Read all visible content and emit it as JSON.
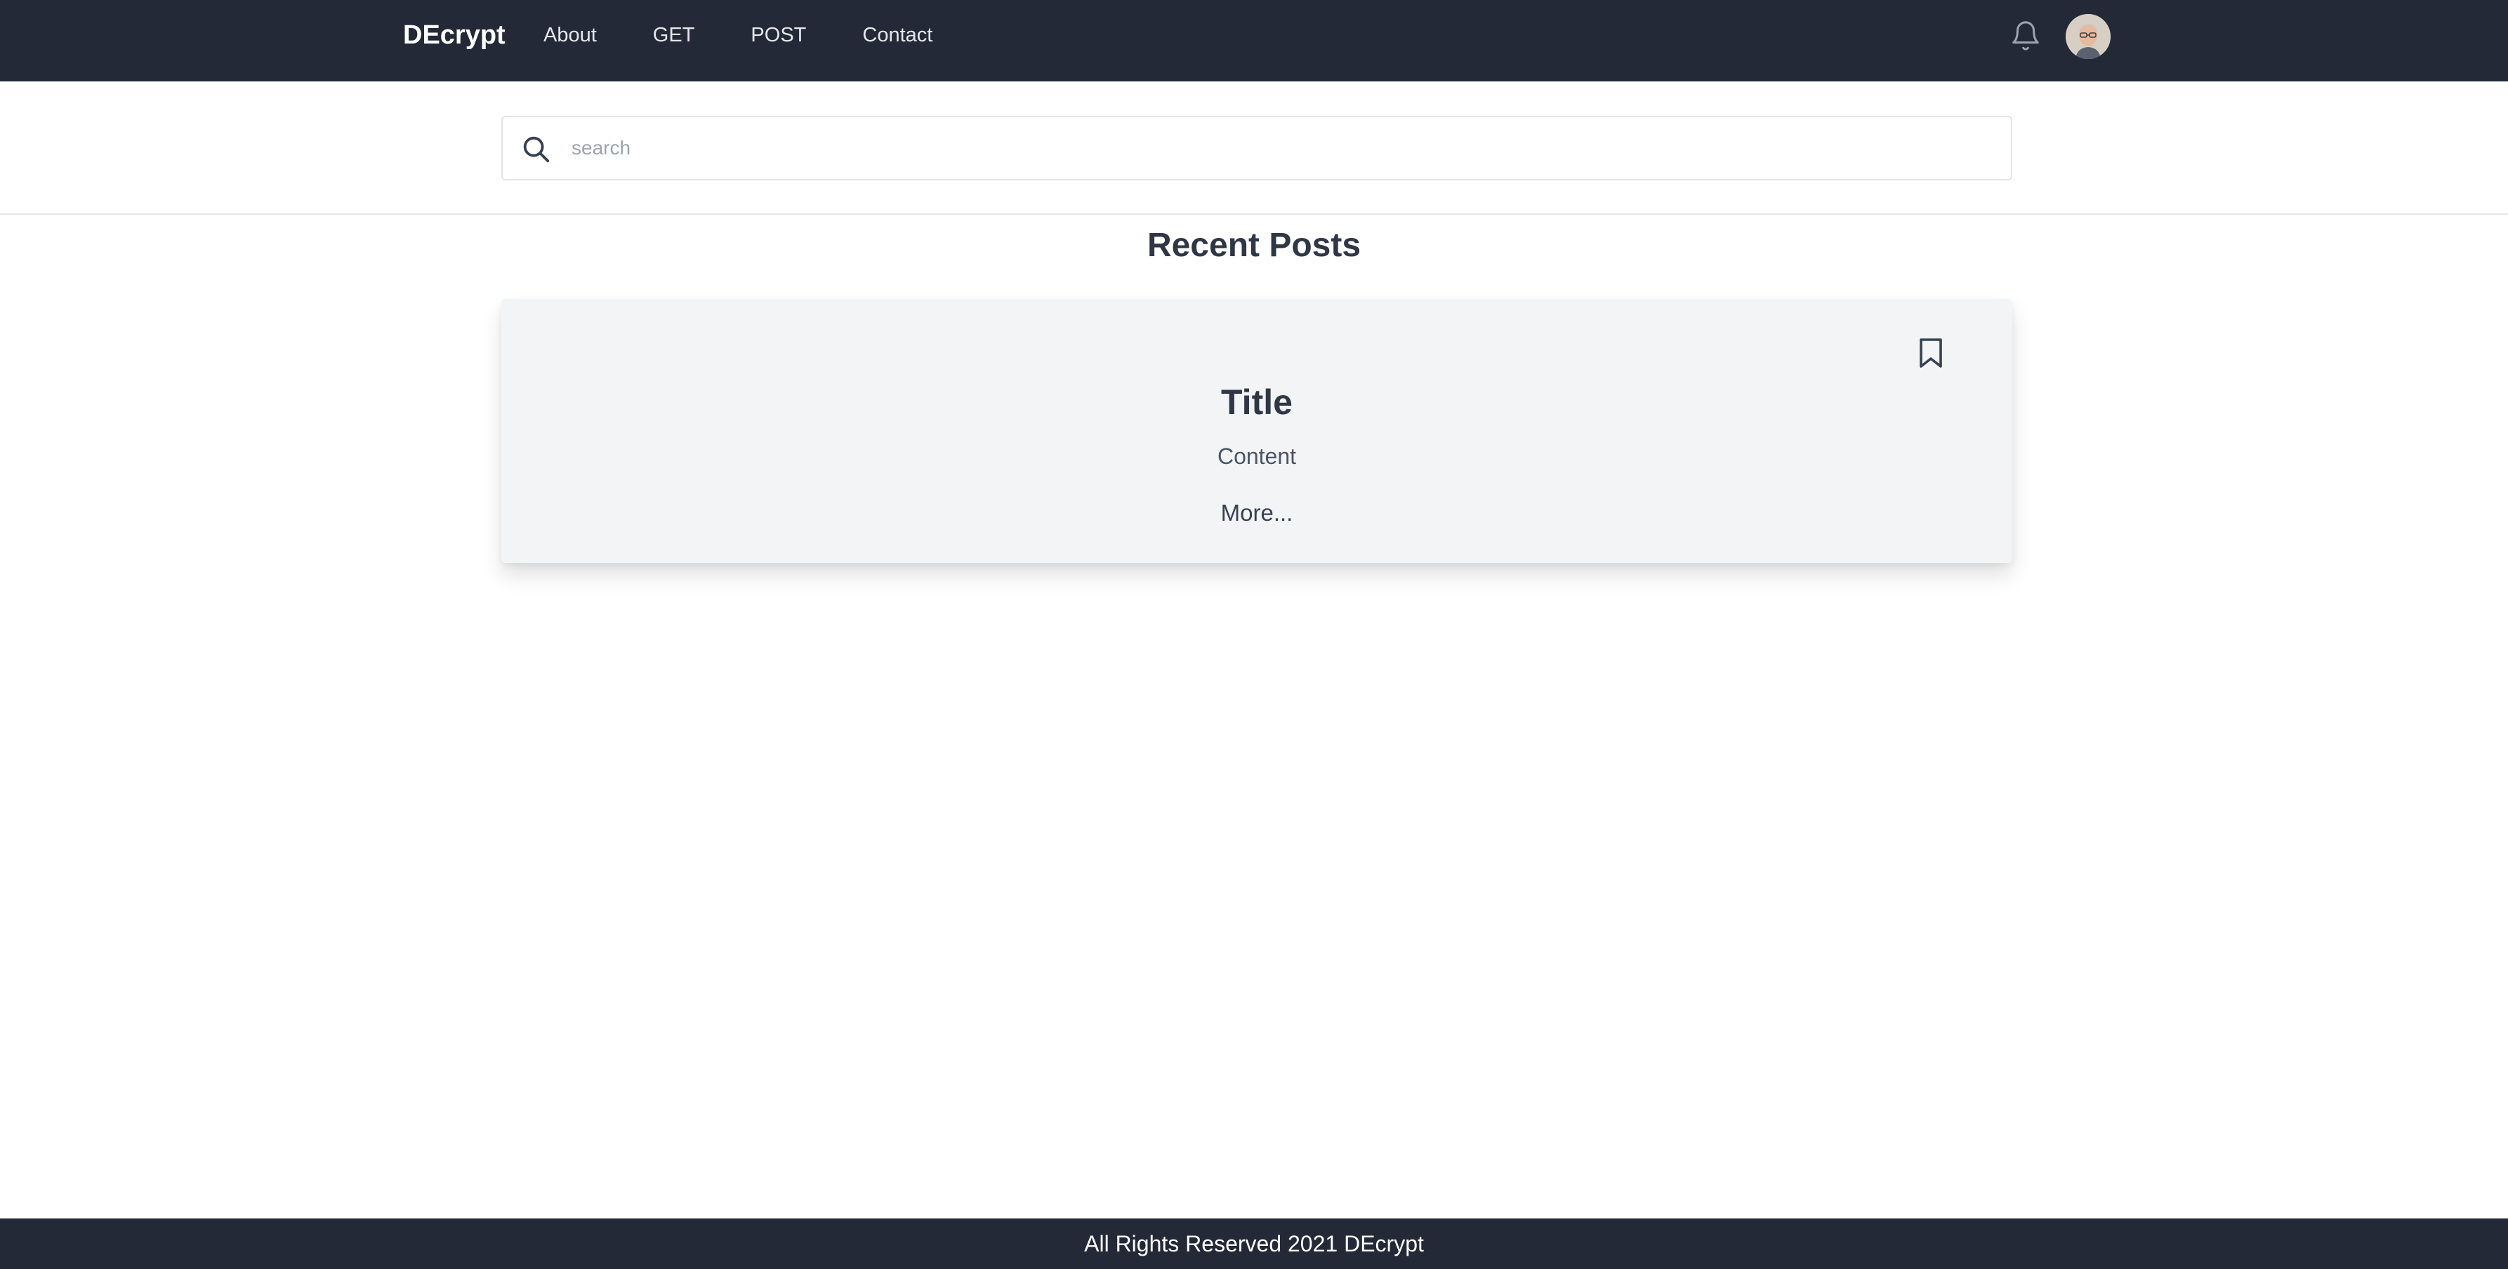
{
  "navbar": {
    "brand": "DEcrypt",
    "links": [
      "About",
      "GET",
      "POST",
      "Contact"
    ],
    "icons": {
      "notifications": "bell-icon",
      "profile": "avatar"
    }
  },
  "search": {
    "placeholder": "search",
    "value": "",
    "icon": "search-icon"
  },
  "main": {
    "heading": "Recent Posts",
    "posts": [
      {
        "title": "Title",
        "content": "Content",
        "more_label": "More...",
        "bookmark_icon": "bookmark-icon"
      }
    ]
  },
  "footer": {
    "text": "All Rights Reserved 2021 DEcrypt"
  },
  "colors": {
    "nav_bg": "#232937",
    "card_bg": "#f3f4f6",
    "heading_text": "#2f3747"
  }
}
